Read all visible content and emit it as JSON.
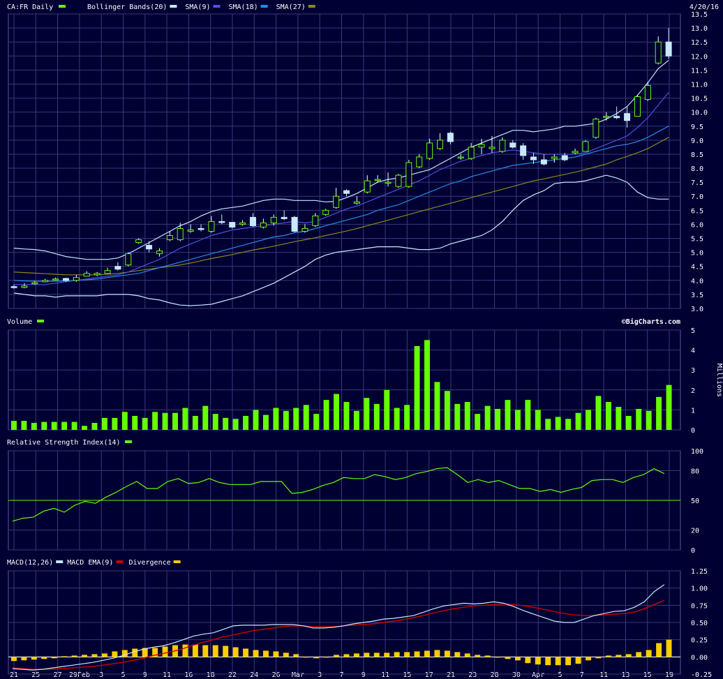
{
  "chart_data": {
    "type": "candlestick",
    "header": {
      "symbol_label": "CA:FR Daily",
      "indicators": [
        {
          "label": "Bollinger Bands(20)",
          "color": "#c8e8ff"
        },
        {
          "label": "SMA(9)",
          "color": "#5050e0"
        },
        {
          "label": "SMA(18)",
          "color": "#2a8ae8"
        },
        {
          "label": "SMA(27)",
          "color": "#8a8a20"
        }
      ],
      "symbol_color": "#66ff00",
      "date": "4/20/16"
    },
    "x_labels": [
      "21",
      "25",
      "27",
      "29Feb",
      "3",
      "5",
      "9",
      "11",
      "16",
      "18",
      "22",
      "24",
      "26",
      "Mar",
      "3",
      "7",
      "9",
      "11",
      "15",
      "17",
      "21",
      "23",
      "28",
      "30",
      "Apr",
      "5",
      "7",
      "11",
      "13",
      "15",
      "19"
    ],
    "price": {
      "ylim": [
        3.0,
        13.5
      ],
      "yticks": [
        "3.0",
        "3.5",
        "4.0",
        "4.5",
        "5.0",
        "5.5",
        "6.0",
        "6.5",
        "7.0",
        "7.5",
        "8.0",
        "8.5",
        "9.0",
        "9.5",
        "10.0",
        "10.5",
        "11.0",
        "11.5",
        "12.0",
        "12.5",
        "13.0",
        "13.5"
      ],
      "close": [
        3.75,
        3.8,
        3.92,
        4.0,
        4.05,
        4.0,
        4.1,
        4.25,
        4.25,
        4.35,
        4.4,
        4.95,
        5.45,
        5.12,
        5.05,
        5.6,
        5.85,
        5.8,
        5.82,
        6.1,
        6.07,
        5.9,
        6.05,
        5.95,
        6.05,
        6.25,
        6.2,
        5.75,
        5.85,
        6.3,
        6.5,
        7.0,
        7.1,
        6.8,
        7.55,
        7.6,
        7.5,
        7.75,
        8.2,
        8.4,
        8.9,
        9.0,
        8.95,
        8.4,
        8.75,
        8.85,
        8.75,
        9.0,
        8.75,
        8.45,
        8.3,
        8.15,
        8.4,
        8.3,
        8.6,
        8.95,
        9.75,
        9.85,
        9.8,
        9.7,
        10.55,
        10.95,
        12.5,
        12.0
      ],
      "open": [
        3.78,
        3.75,
        3.88,
        3.95,
        4.05,
        4.07,
        4.0,
        4.15,
        4.2,
        4.25,
        4.5,
        4.55,
        5.35,
        5.25,
        4.95,
        5.45,
        5.45,
        5.75,
        5.85,
        5.75,
        6.1,
        6.07,
        6.0,
        6.25,
        5.9,
        6.05,
        6.25,
        6.25,
        5.75,
        5.95,
        6.35,
        6.6,
        7.2,
        6.75,
        7.15,
        7.6,
        7.5,
        7.35,
        7.35,
        8.05,
        8.35,
        8.7,
        9.25,
        8.4,
        8.35,
        8.75,
        8.7,
        8.6,
        8.9,
        8.8,
        8.4,
        8.3,
        8.35,
        8.45,
        8.55,
        8.6,
        9.1,
        9.85,
        9.85,
        9.95,
        9.85,
        10.45,
        11.75,
        12.5
      ],
      "high": [
        3.85,
        3.9,
        3.98,
        4.05,
        4.1,
        4.1,
        4.2,
        4.33,
        4.3,
        4.45,
        4.65,
        5.0,
        5.5,
        5.4,
        5.15,
        5.75,
        6.05,
        6.0,
        6.0,
        6.3,
        6.35,
        6.05,
        6.15,
        6.4,
        6.2,
        6.35,
        6.5,
        6.3,
        6.0,
        6.4,
        6.55,
        7.3,
        7.25,
        7.0,
        7.75,
        7.75,
        7.85,
        7.8,
        8.3,
        8.5,
        9.05,
        9.25,
        9.3,
        8.5,
        8.9,
        9.05,
        9.15,
        9.1,
        9.0,
        8.9,
        8.55,
        8.5,
        8.5,
        8.55,
        8.7,
        9.0,
        9.8,
        10.0,
        10.2,
        10.2,
        10.6,
        11.05,
        12.7,
        13.0
      ],
      "low": [
        3.7,
        3.72,
        3.85,
        3.93,
        4.0,
        3.95,
        3.95,
        4.15,
        4.15,
        4.25,
        4.35,
        4.5,
        5.3,
        5.0,
        4.85,
        5.4,
        5.4,
        5.7,
        5.75,
        5.7,
        6.0,
        5.85,
        5.95,
        5.9,
        5.85,
        5.95,
        6.15,
        5.7,
        5.7,
        5.9,
        6.3,
        6.55,
        7.0,
        6.7,
        7.1,
        7.5,
        7.35,
        7.3,
        7.3,
        8.0,
        8.3,
        8.65,
        8.85,
        8.3,
        8.3,
        8.5,
        8.55,
        8.55,
        8.7,
        8.3,
        8.15,
        8.1,
        8.2,
        8.25,
        8.5,
        8.6,
        9.05,
        9.7,
        9.75,
        9.45,
        9.85,
        10.4,
        11.7,
        11.9
      ],
      "bb_upper": [
        5.15,
        5.12,
        5.1,
        5.05,
        4.95,
        4.85,
        4.8,
        4.75,
        4.75,
        4.75,
        4.8,
        4.95,
        5.15,
        5.35,
        5.55,
        5.75,
        5.95,
        6.1,
        6.3,
        6.45,
        6.55,
        6.6,
        6.65,
        6.75,
        6.85,
        6.9,
        6.9,
        6.85,
        6.85,
        6.85,
        6.8,
        6.82,
        6.95,
        7.1,
        7.3,
        7.5,
        7.6,
        7.65,
        7.75,
        7.85,
        7.95,
        8.15,
        8.35,
        8.55,
        8.75,
        8.9,
        9.05,
        9.2,
        9.35,
        9.35,
        9.3,
        9.35,
        9.4,
        9.5,
        9.5,
        9.55,
        9.6,
        9.75,
        9.95,
        10.2,
        10.6,
        11.05,
        11.55,
        11.85
      ],
      "bb_lower": [
        3.55,
        3.5,
        3.45,
        3.45,
        3.4,
        3.45,
        3.45,
        3.45,
        3.45,
        3.5,
        3.5,
        3.5,
        3.45,
        3.35,
        3.3,
        3.2,
        3.12,
        3.1,
        3.12,
        3.15,
        3.25,
        3.35,
        3.45,
        3.6,
        3.75,
        3.9,
        4.1,
        4.3,
        4.5,
        4.75,
        4.9,
        5.0,
        5.05,
        5.1,
        5.15,
        5.2,
        5.2,
        5.2,
        5.15,
        5.1,
        5.1,
        5.15,
        5.3,
        5.4,
        5.5,
        5.6,
        5.8,
        6.1,
        6.5,
        6.85,
        7.05,
        7.2,
        7.45,
        7.5,
        7.5,
        7.55,
        7.65,
        7.75,
        7.65,
        7.5,
        7.15,
        6.95,
        6.9,
        6.9
      ],
      "sma9": [
        3.85,
        3.85,
        3.85,
        3.85,
        3.9,
        3.95,
        4.0,
        4.05,
        4.1,
        4.15,
        4.2,
        4.3,
        4.45,
        4.6,
        4.75,
        4.95,
        5.15,
        5.3,
        5.45,
        5.6,
        5.7,
        5.8,
        5.85,
        5.9,
        5.95,
        6.0,
        6.05,
        6.1,
        6.05,
        6.1,
        6.25,
        6.4,
        6.55,
        6.65,
        6.8,
        6.95,
        7.1,
        7.25,
        7.4,
        7.55,
        7.75,
        7.95,
        8.1,
        8.25,
        8.35,
        8.45,
        8.55,
        8.6,
        8.65,
        8.6,
        8.55,
        8.5,
        8.5,
        8.5,
        8.5,
        8.55,
        8.7,
        8.85,
        9.0,
        9.15,
        9.45,
        9.8,
        10.25,
        10.7
      ],
      "sma18": [
        4.0,
        3.98,
        3.97,
        3.97,
        3.97,
        3.98,
        4.0,
        4.02,
        4.05,
        4.1,
        4.15,
        4.2,
        4.25,
        4.35,
        4.45,
        4.55,
        4.65,
        4.75,
        4.85,
        4.95,
        5.05,
        5.15,
        5.25,
        5.35,
        5.45,
        5.55,
        5.6,
        5.7,
        5.75,
        5.85,
        5.95,
        6.05,
        6.15,
        6.25,
        6.35,
        6.5,
        6.6,
        6.7,
        6.85,
        7.0,
        7.15,
        7.3,
        7.45,
        7.55,
        7.7,
        7.8,
        7.9,
        8.0,
        8.1,
        8.15,
        8.2,
        8.25,
        8.3,
        8.35,
        8.4,
        8.5,
        8.6,
        8.7,
        8.8,
        8.85,
        8.95,
        9.1,
        9.3,
        9.5
      ],
      "sma27": [
        4.3,
        4.28,
        4.26,
        4.24,
        4.22,
        4.2,
        4.2,
        4.2,
        4.2,
        4.22,
        4.25,
        4.3,
        4.35,
        4.4,
        4.45,
        4.5,
        4.55,
        4.62,
        4.7,
        4.78,
        4.85,
        4.92,
        5.0,
        5.08,
        5.15,
        5.22,
        5.3,
        5.38,
        5.45,
        5.52,
        5.6,
        5.68,
        5.76,
        5.85,
        5.95,
        6.05,
        6.15,
        6.25,
        6.35,
        6.45,
        6.55,
        6.65,
        6.75,
        6.85,
        6.95,
        7.05,
        7.15,
        7.25,
        7.35,
        7.45,
        7.55,
        7.62,
        7.7,
        7.78,
        7.86,
        7.95,
        8.05,
        8.15,
        8.3,
        8.42,
        8.55,
        8.7,
        8.9,
        9.1
      ]
    },
    "volume": {
      "label": "Volume",
      "unit_label": "Millions",
      "watermark": "©BigCharts.com",
      "ylim": [
        0,
        5
      ],
      "yticks": [
        "0",
        "1",
        "2",
        "3",
        "4",
        "5"
      ],
      "values": [
        0.45,
        0.45,
        0.35,
        0.4,
        0.4,
        0.4,
        0.4,
        0.2,
        0.35,
        0.6,
        0.6,
        0.9,
        0.7,
        0.6,
        0.9,
        0.85,
        0.85,
        1.1,
        0.7,
        1.2,
        0.8,
        0.6,
        0.55,
        0.7,
        1.0,
        0.75,
        1.1,
        0.95,
        1.1,
        1.25,
        0.8,
        1.5,
        1.8,
        1.4,
        0.95,
        1.6,
        1.3,
        2.0,
        1.1,
        1.25,
        4.2,
        4.5,
        2.4,
        1.95,
        1.3,
        1.4,
        0.8,
        1.2,
        1.05,
        1.5,
        1.0,
        1.5,
        1.0,
        0.55,
        0.65,
        0.55,
        0.85,
        1.0,
        1.7,
        1.4,
        1.15,
        0.7,
        1.05,
        0.95,
        1.65,
        2.25
      ]
    },
    "rsi": {
      "label": "Relative Strength Index(14)",
      "ylim": [
        0,
        100
      ],
      "yticks": [
        "0",
        "20",
        "50",
        "80",
        "100"
      ],
      "values": [
        29,
        32,
        33,
        39,
        42,
        38,
        45,
        49,
        47,
        53,
        58,
        64,
        69,
        62,
        62,
        69,
        72,
        67,
        68,
        72,
        68,
        66,
        66,
        66,
        69,
        69,
        69,
        57,
        58,
        61,
        65,
        68,
        73,
        72,
        72,
        76,
        74,
        71,
        73,
        77,
        79,
        82,
        83,
        76,
        68,
        71,
        68,
        70,
        66,
        62,
        62,
        59,
        61,
        58,
        61,
        63,
        70,
        71,
        71,
        68,
        73,
        76,
        82,
        77
      ]
    },
    "macd": {
      "label": "MACD(12,26)",
      "legend": [
        {
          "label": "MACD EMA(9)",
          "color": "#c8e8ff"
        },
        {
          "label": "Divergence",
          "color": "#cc0000"
        },
        {
          "label": "",
          "color": "#ffcc00"
        }
      ],
      "ylim": [
        -0.25,
        1.25
      ],
      "yticks": [
        "-0.25",
        "0.00",
        "0.25",
        "0.50",
        "0.75",
        "1.00",
        "1.25"
      ],
      "macd": [
        -0.17,
        -0.18,
        -0.19,
        -0.18,
        -0.16,
        -0.14,
        -0.12,
        -0.1,
        -0.08,
        -0.05,
        -0.02,
        0.02,
        0.07,
        0.11,
        0.14,
        0.16,
        0.2,
        0.25,
        0.3,
        0.33,
        0.35,
        0.4,
        0.45,
        0.46,
        0.46,
        0.46,
        0.47,
        0.47,
        0.47,
        0.45,
        0.42,
        0.42,
        0.43,
        0.45,
        0.48,
        0.5,
        0.52,
        0.55,
        0.56,
        0.58,
        0.6,
        0.65,
        0.7,
        0.74,
        0.76,
        0.78,
        0.77,
        0.78,
        0.8,
        0.78,
        0.73,
        0.67,
        0.62,
        0.57,
        0.52,
        0.5,
        0.5,
        0.55,
        0.6,
        0.63,
        0.66,
        0.67,
        0.72,
        0.8,
        0.95,
        1.05
      ],
      "signal": [
        -0.16,
        -0.17,
        -0.18,
        -0.18,
        -0.18,
        -0.17,
        -0.16,
        -0.15,
        -0.14,
        -0.12,
        -0.1,
        -0.08,
        -0.05,
        -0.02,
        0.02,
        0.05,
        0.08,
        0.12,
        0.17,
        0.21,
        0.25,
        0.29,
        0.32,
        0.35,
        0.38,
        0.4,
        0.42,
        0.44,
        0.45,
        0.45,
        0.44,
        0.44,
        0.44,
        0.45,
        0.46,
        0.47,
        0.48,
        0.5,
        0.52,
        0.54,
        0.57,
        0.6,
        0.64,
        0.67,
        0.7,
        0.72,
        0.74,
        0.75,
        0.76,
        0.77,
        0.76,
        0.74,
        0.72,
        0.69,
        0.66,
        0.63,
        0.61,
        0.6,
        0.6,
        0.61,
        0.62,
        0.63,
        0.65,
        0.7,
        0.76,
        0.82
      ],
      "divergence": [
        -0.06,
        -0.05,
        -0.04,
        -0.03,
        -0.02,
        0.01,
        0.02,
        0.03,
        0.04,
        0.05,
        0.08,
        0.1,
        0.12,
        0.13,
        0.13,
        0.15,
        0.17,
        0.18,
        0.18,
        0.17,
        0.17,
        0.16,
        0.14,
        0.12,
        0.1,
        0.09,
        0.08,
        0.06,
        0.04,
        -0.01,
        -0.02,
        0.0,
        0.03,
        0.04,
        0.05,
        0.06,
        0.06,
        0.06,
        0.07,
        0.07,
        0.08,
        0.09,
        0.1,
        0.09,
        0.07,
        0.05,
        0.03,
        0.02,
        0.0,
        -0.03,
        -0.05,
        -0.09,
        -0.11,
        -0.12,
        -0.12,
        -0.12,
        -0.1,
        -0.05,
        -0.02,
        0.02,
        0.03,
        0.04,
        0.07,
        0.1,
        0.2,
        0.25
      ]
    }
  }
}
